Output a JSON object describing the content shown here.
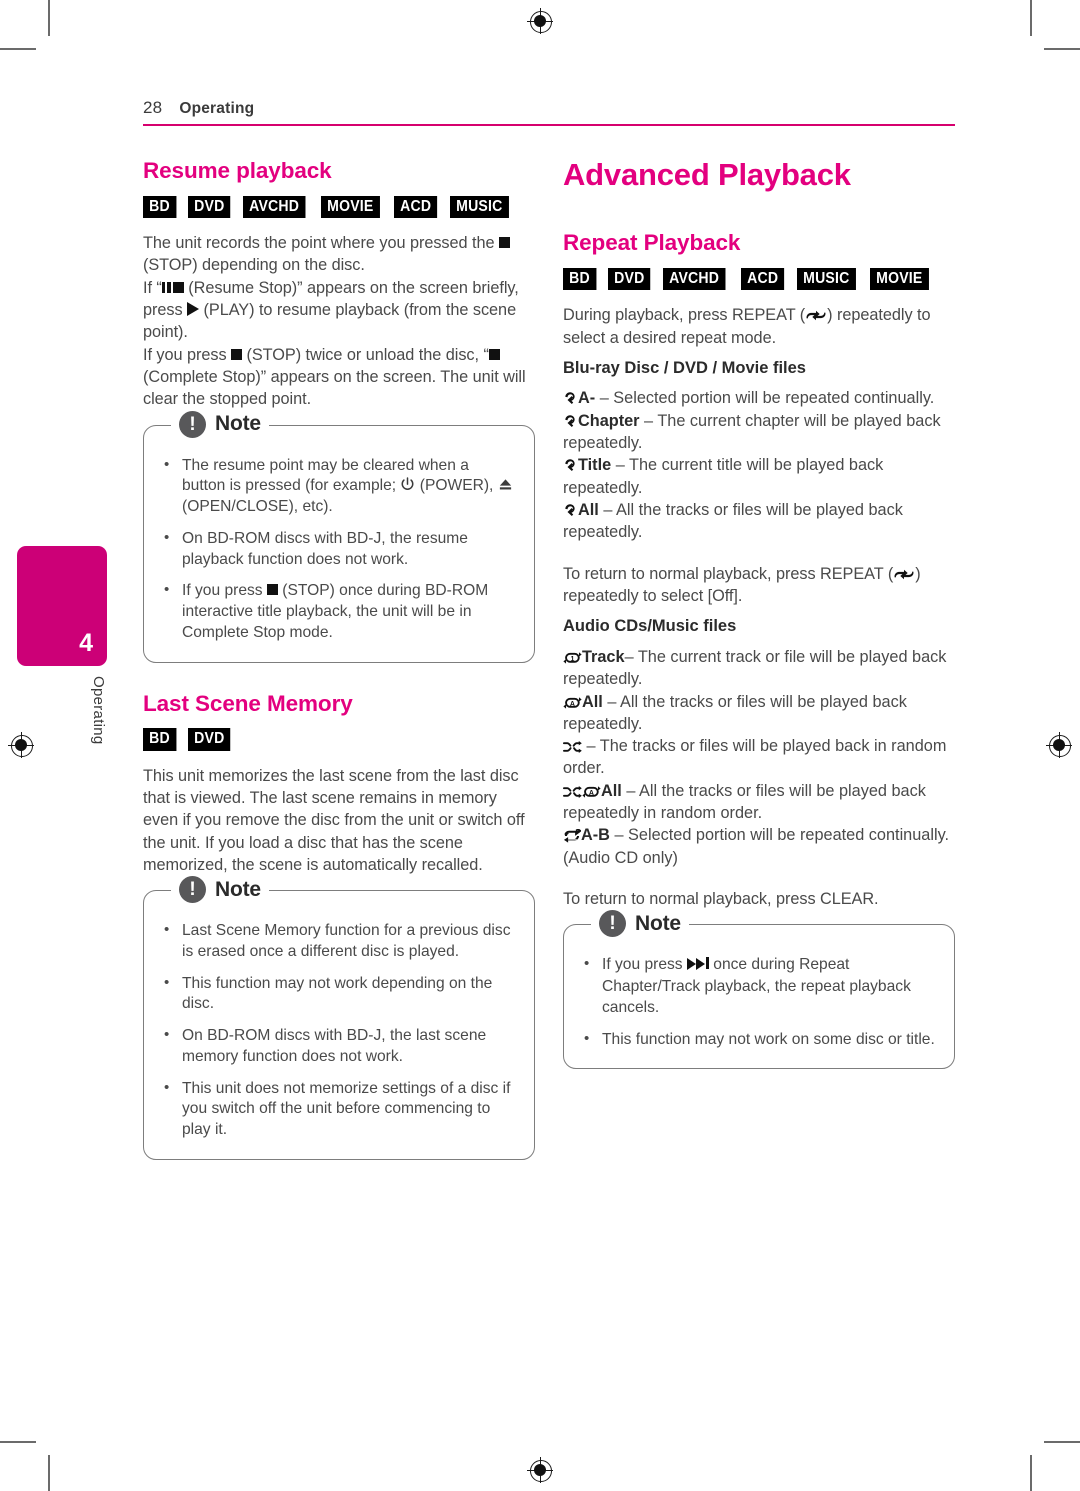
{
  "page": {
    "number": "28",
    "section": "Operating",
    "chapter_number": "4",
    "chapter_label": "Operating",
    "accent_color": "#e3007f",
    "tab_color": "#cc0077"
  },
  "left_column": {
    "section1": {
      "heading": "Resume playback",
      "badges": [
        "BD",
        "DVD",
        "AVCHD",
        "MOVIE",
        "ACD",
        "MUSIC"
      ],
      "paragraph_parts": {
        "p1_a": "The unit records the point where you pressed the ",
        "p1_b": " (STOP) depending on the disc.",
        "p2_a": "If “",
        "p2_b": " (Resume Stop)” appears on the screen briefly, press ",
        "p2_c": " (PLAY) to resume playback (from the scene point).",
        "p3_a": "If you press ",
        "p3_b": " (STOP) twice or unload the disc, “",
        "p3_c": "(Complete Stop)” appears on the screen. The unit will clear the stopped point."
      },
      "note": {
        "title": "Note",
        "items": [
          {
            "a": "The resume point may be cleared when a button is pressed (for example; ",
            "b": " (POWER), ",
            "c": " (OPEN/CLOSE), etc)."
          },
          {
            "a": "On BD-ROM discs with BD-J, the resume playback function does not work.",
            "b": "",
            "c": ""
          },
          {
            "a": "If you press ",
            "b": " (STOP) once during BD-ROM interactive title playback, the unit will be in Complete Stop mode.",
            "c": ""
          }
        ]
      }
    },
    "section2": {
      "heading": "Last Scene Memory",
      "badges": [
        "BD",
        "DVD"
      ],
      "paragraph": "This unit memorizes the last scene from the last disc that is viewed. The last scene remains in memory even if you remove the disc from the unit or switch off the unit. If you load a disc that has the scene memorized, the scene is automatically recalled.",
      "note": {
        "title": "Note",
        "items": [
          "Last Scene Memory function for a previous disc is erased once a different disc is played.",
          "This function may not work depending on the disc.",
          "On BD-ROM discs with BD-J, the last scene memory function does not work.",
          "This unit does not memorize settings of a disc if you switch off the unit before commencing to play it."
        ]
      }
    }
  },
  "right_column": {
    "title": "Advanced Playback",
    "section1": {
      "heading": "Repeat Playback",
      "badges": [
        "BD",
        "DVD",
        "AVCHD",
        "ACD",
        "MUSIC",
        "MOVIE"
      ],
      "intro_a": "During playback, press REPEAT (",
      "intro_b": ") repeatedly to select a desired repeat mode.",
      "group1_title": "Blu-ray Disc / DVD / Movie files",
      "group1_items": [
        {
          "label": "A-",
          "text": " – Selected portion will be repeated continually.",
          "icon": "repeat-arrow-icon"
        },
        {
          "label": "Chapter",
          "text": " – The current chapter will be played back repeatedly.",
          "icon": "repeat-arrow-icon"
        },
        {
          "label": "Title",
          "text": " – The current title will be played back repeatedly.",
          "icon": "repeat-arrow-icon"
        },
        {
          "label": "All",
          "text": " – All the tracks or files will be played back repeatedly.",
          "icon": "repeat-arrow-icon"
        }
      ],
      "return_a": "To return to normal playback, press REPEAT (",
      "return_b": ") repeatedly to select [Off].",
      "group2_title": "Audio CDs/Music files",
      "group2_items": [
        {
          "label": "Track",
          "text": "– The current track or file will be played back repeatedly.",
          "icon": "repeat-one-icon"
        },
        {
          "label": "All",
          "text": " – All the tracks or files will be played back repeatedly.",
          "icon": "repeat-all-icon"
        },
        {
          "label": "",
          "text": " – The tracks or files will be played back in random order.",
          "icon": "shuffle-icon"
        },
        {
          "label": "All",
          "text": " – All the tracks or files will be played back repeatedly in random order.",
          "icon": "shuffle-repeat-all-icon"
        },
        {
          "label": "A-B",
          "text": " – Selected portion will be repeated continually. (Audio CD only)",
          "icon": "repeat-ab-icon"
        }
      ],
      "clear_text": "To return to normal playback, press CLEAR.",
      "note": {
        "title": "Note",
        "items": [
          {
            "a": "If you press ",
            "b": " once during Repeat Chapter/Track playback, the repeat playback cancels."
          },
          {
            "a": "This function may not work on some disc or title.",
            "b": ""
          }
        ]
      }
    }
  }
}
